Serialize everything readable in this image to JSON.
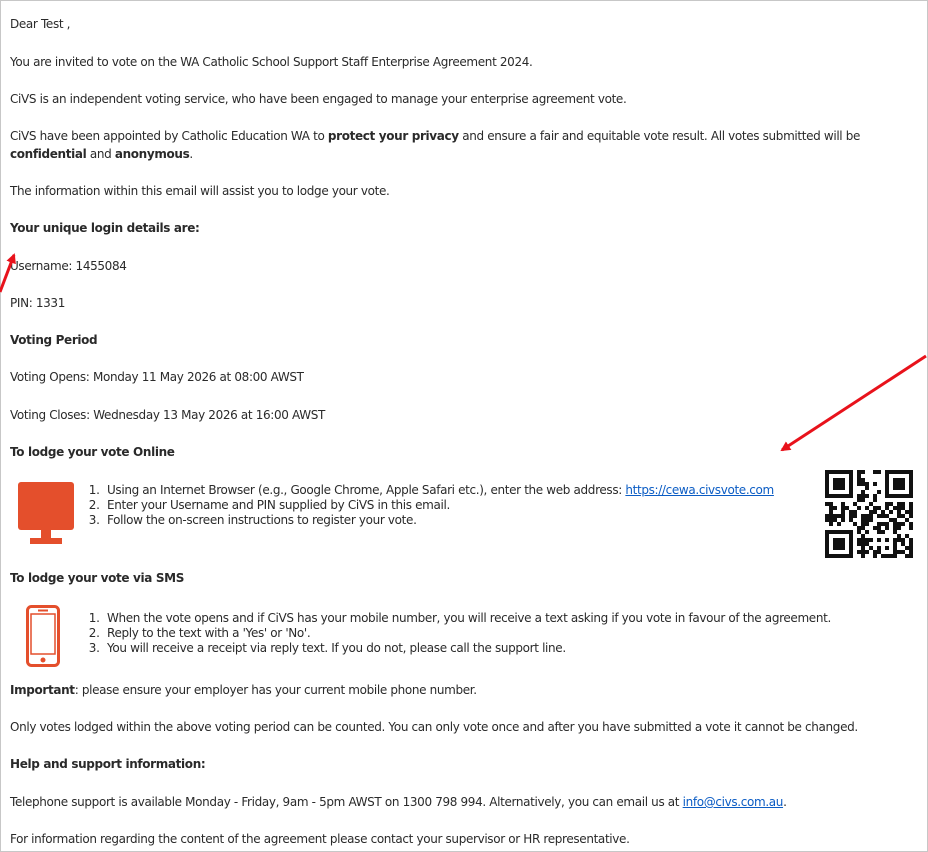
{
  "colors": {
    "accent_icon": "#e44f2c",
    "link": "#0b5cc4",
    "arrow": "#e8121b"
  },
  "greeting": "Dear Test ,",
  "p_invite": "You are invited to vote on the WA Catholic School Support Staff Enterprise Agreement 2024.",
  "p_civs": "CiVS is an independent voting service, who have been engaged to manage your enterprise agreement vote.",
  "p_privacy": {
    "a": "CiVS have been appointed by Catholic Education WA to ",
    "b": "protect your privacy",
    "c": " and ensure a fair and equitable vote result. All votes submitted will be ",
    "d": "confidential",
    "e": " and ",
    "f": "anonymous",
    "g": "."
  },
  "p_info": "The information within this email will assist you to lodge your vote.",
  "login": {
    "heading": "Your unique login details are:",
    "username": "Username:  1455084",
    "pin": "PIN:  1331"
  },
  "voting": {
    "heading": "Voting Period",
    "opens": "Voting Opens: Monday 11 May 2026 at 08:00 AWST",
    "closes": "Voting Closes: Wednesday 13 May 2026 at 16:00 AWST"
  },
  "online": {
    "heading": "To lodge your vote Online",
    "icon": "monitor-icon",
    "step1": "Using an Internet Browser (e.g., Google Chrome, Apple Safari etc.), enter the web address: ",
    "url": "https://cewa.civsvote.com",
    "step2": "Enter your Username and PIN supplied by CiVS in this email.",
    "step3": "Follow the on-screen instructions to register your vote.",
    "qr": "qr-code"
  },
  "sms": {
    "heading": "To lodge your vote via SMS",
    "icon": "mobile-phone-icon",
    "step1": "When the vote opens and if CiVS has your mobile number, you will receive a text asking if you vote in favour of the agreement.",
    "step2": "Reply to the text with a 'Yes' or 'No'.",
    "step3": "You will receive a receipt via reply text. If you do not, please call the support line."
  },
  "important": {
    "label": "Important",
    "text": ": please ensure your employer has your current mobile phone number."
  },
  "p_only": "Only votes lodged within the above voting period can be counted. You can only vote once and after you have submitted a vote it cannot be changed.",
  "help": {
    "heading": "Help and support information:",
    "text": "Telephone support is available Monday - Friday, 9am - 5pm AWST on 1300 798 994. Alternatively, you can email us at ",
    "email": "info@civs.com.au",
    "end": "."
  },
  "p_content": "For information regarding the content of the agreement please contact your supervisor or HR representative."
}
